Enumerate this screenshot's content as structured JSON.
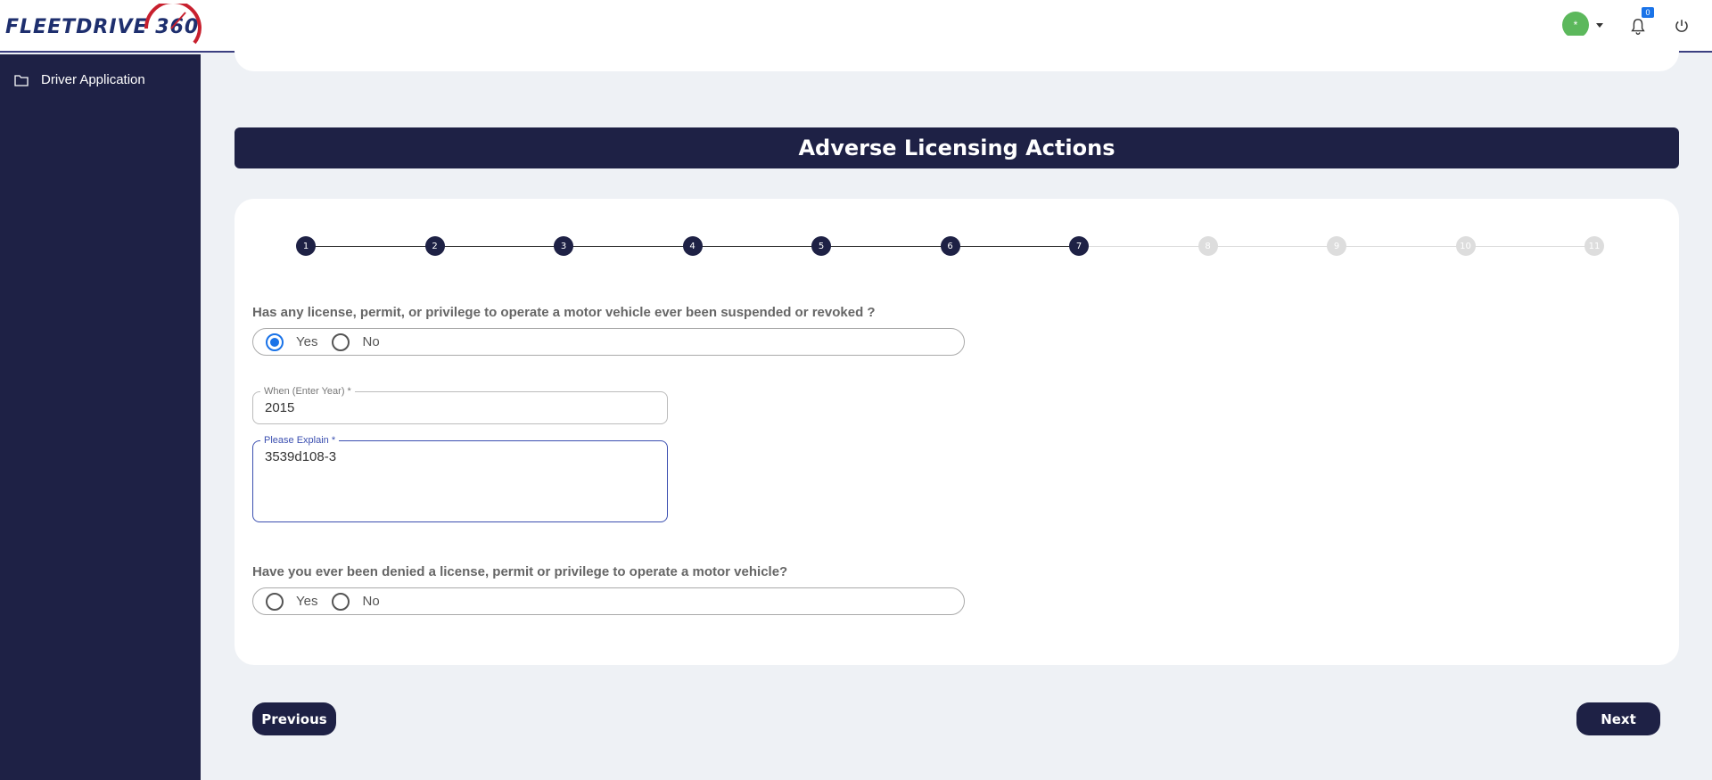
{
  "header": {
    "logo_text": "FLEETDRIVE 360",
    "avatar_initial": "*",
    "notification_count": "0"
  },
  "sidebar": {
    "items": [
      {
        "label": "Driver Application",
        "icon": "folder-icon"
      }
    ]
  },
  "page": {
    "title": "Adverse Licensing Actions"
  },
  "stepper": {
    "steps": [
      "1",
      "2",
      "3",
      "4",
      "5",
      "6",
      "7",
      "8",
      "9",
      "10",
      "11"
    ],
    "current_step": 7,
    "active_color": "#1e2145",
    "inactive_color": "#dddddd"
  },
  "form": {
    "question1": "Has any license, permit, or privilege to operate a motor vehicle ever been suspended or revoked ?",
    "q1_options": [
      "Yes",
      "No"
    ],
    "q1_selected": "Yes",
    "when_label": "When (Enter Year) *",
    "when_value": "2015",
    "explain_label": "Please Explain *",
    "explain_value": "3539d108-3",
    "question2": "Have you ever been denied a license, permit or privilege to operate a motor vehicle?",
    "q2_options": [
      "Yes",
      "No"
    ],
    "q2_selected": ""
  },
  "buttons": {
    "previous": "Previous",
    "next": "Next"
  },
  "colors": {
    "navy": "#1e2145",
    "accent": "#1a73e8",
    "avatar": "#5cb85c"
  }
}
